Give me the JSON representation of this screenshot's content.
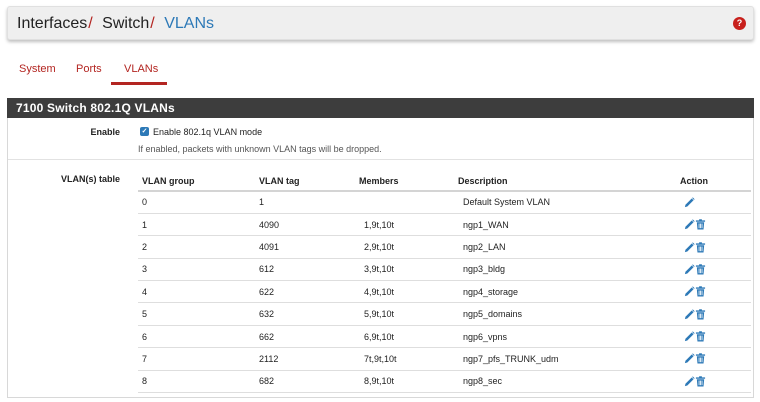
{
  "breadcrumb": {
    "items": [
      "Interfaces",
      "Switch",
      "VLANs"
    ],
    "separator": "/"
  },
  "help_icon": "?",
  "tabs": [
    {
      "label": "System",
      "active": false
    },
    {
      "label": "Ports",
      "active": false
    },
    {
      "label": "VLANs",
      "active": true
    }
  ],
  "panel": {
    "title": "7100 Switch 802.1Q VLANs"
  },
  "enable": {
    "label": "Enable",
    "checkbox_label": "Enable 802.1q VLAN mode",
    "checked": true,
    "help": "If enabled, packets with unknown VLAN tags will be dropped."
  },
  "vlan_table": {
    "label": "VLAN(s) table",
    "columns": [
      "VLAN group",
      "VLAN tag",
      "Members",
      "Description",
      "Action"
    ],
    "rows": [
      {
        "group": "0",
        "tag": "1",
        "members": "",
        "description": "Default System VLAN",
        "deletable": false
      },
      {
        "group": "1",
        "tag": "4090",
        "members": "1,9t,10t",
        "description": "ngp1_WAN",
        "deletable": true
      },
      {
        "group": "2",
        "tag": "4091",
        "members": "2,9t,10t",
        "description": "ngp2_LAN",
        "deletable": true
      },
      {
        "group": "3",
        "tag": "612",
        "members": "3,9t,10t",
        "description": "ngp3_bldg",
        "deletable": true
      },
      {
        "group": "4",
        "tag": "622",
        "members": "4,9t,10t",
        "description": "ngp4_storage",
        "deletable": true
      },
      {
        "group": "5",
        "tag": "632",
        "members": "5,9t,10t",
        "description": "ngp5_domains",
        "deletable": true
      },
      {
        "group": "6",
        "tag": "662",
        "members": "6,9t,10t",
        "description": "ngp6_vpns",
        "deletable": true
      },
      {
        "group": "7",
        "tag": "2112",
        "members": "7t,9t,10t",
        "description": "ngp7_pfs_TRUNK_udm",
        "deletable": true
      },
      {
        "group": "8",
        "tag": "682",
        "members": "8,9t,10t",
        "description": "ngp8_sec",
        "deletable": true
      }
    ]
  },
  "icons": {
    "edit": "pencil-icon",
    "delete": "trash-icon"
  },
  "colors": {
    "accent_red": "#b32521",
    "link_blue": "#2d79b7",
    "panel_heading_bg": "#3d3d3d"
  }
}
